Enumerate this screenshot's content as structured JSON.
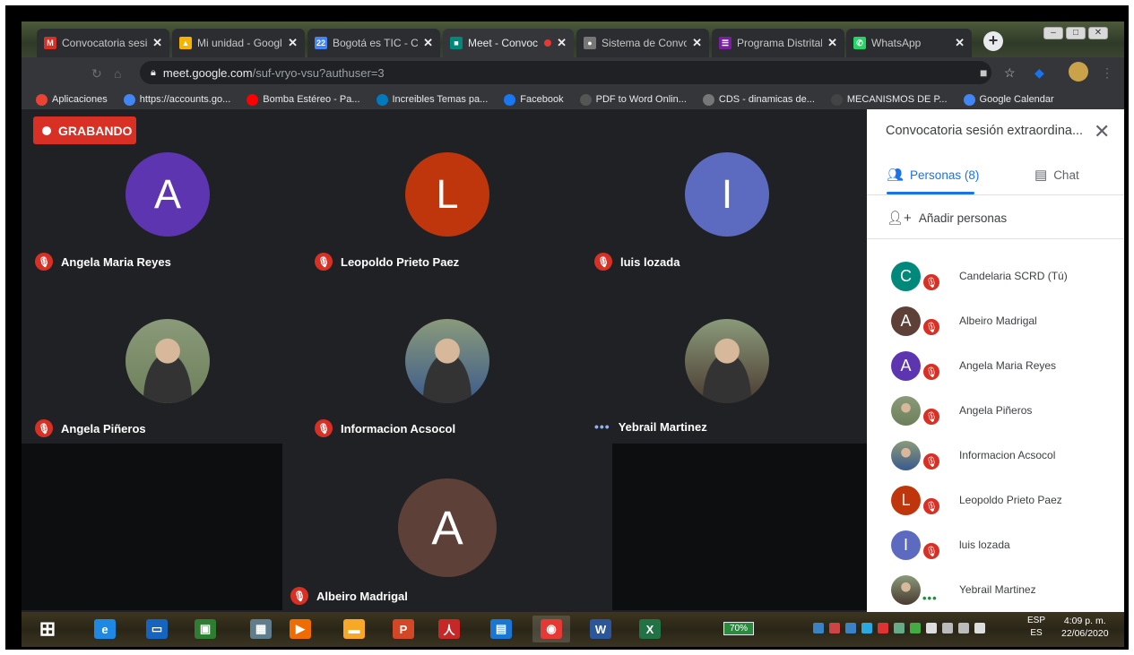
{
  "browser": {
    "tabs": [
      {
        "label": "Convocatoria sesió",
        "icon": "gmail-icon",
        "color": "#d93025",
        "glyph": "M",
        "active": false
      },
      {
        "label": "Mi unidad - Google",
        "icon": "google-drive-icon",
        "color": "#f4b400",
        "glyph": "▲",
        "active": false
      },
      {
        "label": "Bogotá es TIC - Ca",
        "icon": "calendar-icon",
        "color": "#4285f4",
        "glyph": "22",
        "active": false
      },
      {
        "label": "Meet - Convoc",
        "icon": "meet-icon",
        "color": "#00897b",
        "glyph": "■",
        "active": true
      },
      {
        "label": "Sistema de Convoc",
        "icon": "globe-icon",
        "color": "#777",
        "glyph": "●",
        "active": false
      },
      {
        "label": "Programa Distrital",
        "icon": "forms-icon",
        "color": "#7b1fa2",
        "glyph": "☰",
        "active": false
      },
      {
        "label": "WhatsApp",
        "icon": "whatsapp-icon",
        "color": "#25d366",
        "glyph": "✆",
        "active": false
      }
    ],
    "url_domain": "meet.google.com",
    "url_path": "/suf-vryo-vsu?authuser=3",
    "bookmarks": [
      {
        "label": "Aplicaciones",
        "icon": "apps-grid-icon",
        "color": "#ea4335"
      },
      {
        "label": "https://accounts.go...",
        "icon": "google-icon",
        "color": "#4285f4"
      },
      {
        "label": "Bomba Estéreo - Pa...",
        "icon": "youtube-icon",
        "color": "#ff0000"
      },
      {
        "label": "Increibles Temas pa...",
        "icon": "trello-icon",
        "color": "#0079bf"
      },
      {
        "label": "Facebook",
        "icon": "facebook-icon",
        "color": "#1877f2"
      },
      {
        "label": "PDF to Word Onlin...",
        "icon": "pdf-icon",
        "color": "#555"
      },
      {
        "label": "CDS - dinamicas de...",
        "icon": "globe-icon",
        "color": "#777"
      },
      {
        "label": "MECANISMOS DE P...",
        "icon": "page-icon",
        "color": "#444"
      },
      {
        "label": "Google Calendar",
        "icon": "google-icon",
        "color": "#4285f4"
      }
    ]
  },
  "meet": {
    "recording_label": "GRABANDO",
    "tiles": [
      {
        "name": "Angela Maria Reyes",
        "initial": "A",
        "color": "#5e35b1",
        "muted": true
      },
      {
        "name": "Leopoldo Prieto Paez",
        "initial": "L",
        "color": "#bf360c",
        "muted": true
      },
      {
        "name": "luis lozada",
        "initial": "I",
        "color": "#5c6bc0",
        "muted": true
      },
      {
        "name": "Angela Piñeros",
        "initial": "",
        "color": "#6d7f5a",
        "muted": true
      },
      {
        "name": "Informacion Acsocol",
        "initial": "",
        "color": "#3a5a8c",
        "muted": true
      },
      {
        "name": "Yebrail Martinez",
        "initial": "",
        "color": "#4a3a30",
        "muted": false
      },
      {
        "name": "Albeiro Madrigal",
        "initial": "A",
        "color": "#5d4037",
        "muted": true
      }
    ]
  },
  "panel": {
    "title": "Convocatoria sesión extraordina...",
    "tab_people": "Personas (8)",
    "tab_chat": "Chat",
    "add_people": "Añadir personas",
    "participants": [
      {
        "name": "Candelaria SCRD (Tú)",
        "initial": "C",
        "color": "#00897b",
        "muted": true
      },
      {
        "name": "Albeiro Madrigal",
        "initial": "A",
        "color": "#5d4037",
        "muted": true
      },
      {
        "name": "Angela Maria Reyes",
        "initial": "A",
        "color": "#5e35b1",
        "muted": true
      },
      {
        "name": "Angela Piñeros",
        "initial": "",
        "color": "#6d7f5a",
        "muted": true
      },
      {
        "name": "Informacion Acsocol",
        "initial": "",
        "color": "#3a5a8c",
        "muted": true
      },
      {
        "name": "Leopoldo Prieto Paez",
        "initial": "L",
        "color": "#bf360c",
        "muted": true
      },
      {
        "name": "luis lozada",
        "initial": "I",
        "color": "#5c6bc0",
        "muted": true
      },
      {
        "name": "Yebrail Martinez",
        "initial": "",
        "color": "#4a3a30",
        "muted": false
      }
    ]
  },
  "taskbar": {
    "apps": [
      {
        "name": "windows-start-icon",
        "color": "#ffffff",
        "glyph": "⊞"
      },
      {
        "name": "internet-explorer-icon",
        "color": "#1e88e5",
        "glyph": "e"
      },
      {
        "name": "lenovo-icon",
        "color": "#1565c0",
        "glyph": "▭"
      },
      {
        "name": "store-icon",
        "color": "#2e7d32",
        "glyph": "▣"
      },
      {
        "name": "calculator-icon",
        "color": "#607d8b",
        "glyph": "▦"
      },
      {
        "name": "media-player-icon",
        "color": "#ef6c00",
        "glyph": "▶"
      },
      {
        "name": "file-explorer-icon",
        "color": "#f9a825",
        "glyph": "▬"
      },
      {
        "name": "powerpoint-icon",
        "color": "#d24726",
        "glyph": "P"
      },
      {
        "name": "acrobat-icon",
        "color": "#c62828",
        "glyph": "人"
      },
      {
        "name": "remote-desktop-icon",
        "color": "#1976d2",
        "glyph": "▤"
      },
      {
        "name": "chrome-icon",
        "color": "#e53935",
        "glyph": "◉"
      },
      {
        "name": "word-icon",
        "color": "#2b579a",
        "glyph": "W"
      },
      {
        "name": "excel-icon",
        "color": "#217346",
        "glyph": "X"
      }
    ],
    "battery": "70%",
    "lang_top": "ESP",
    "lang_bottom": "ES",
    "time": "4:09 p. m.",
    "date": "22/06/2020"
  }
}
